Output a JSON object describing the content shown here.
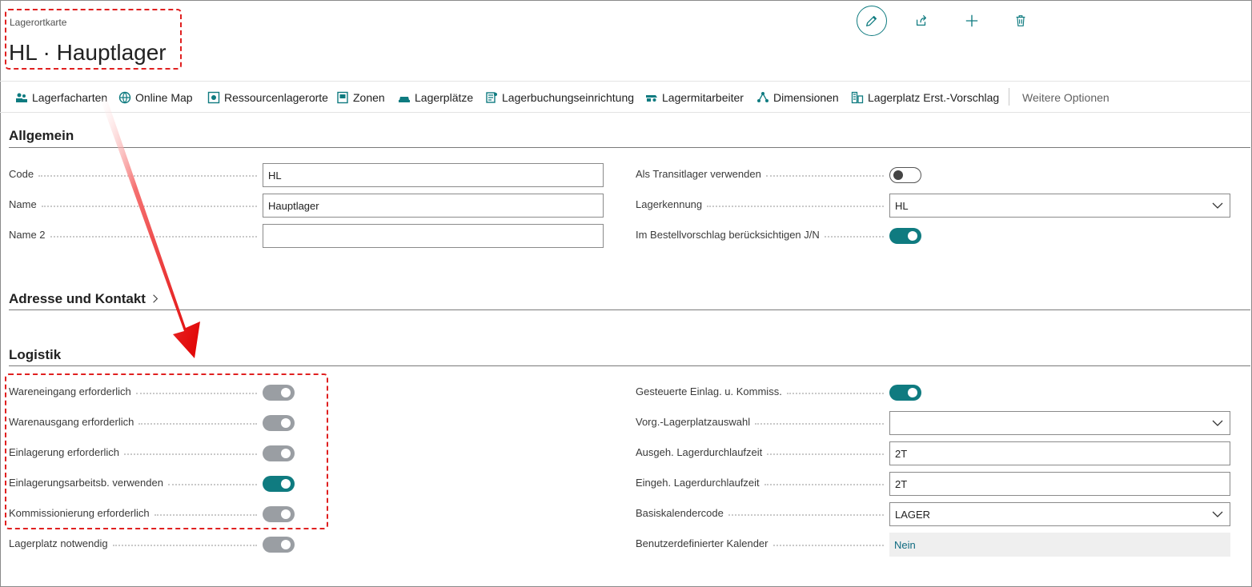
{
  "header": {
    "caption": "Lagerortkarte",
    "title": "HL · Hauptlager"
  },
  "top_actions": [
    {
      "name": "edit-icon"
    },
    {
      "name": "share-icon"
    },
    {
      "name": "plus-icon"
    },
    {
      "name": "delete-icon"
    }
  ],
  "actionbar": {
    "items": [
      {
        "label": "Lagerfacharten",
        "icon": "bin-types-icon"
      },
      {
        "label": "Online Map",
        "icon": "globe-icon"
      },
      {
        "label": "Ressourcenlagerorte",
        "icon": "resource-icon"
      },
      {
        "label": "Zonen",
        "icon": "zone-icon"
      },
      {
        "label": "Lagerplätze",
        "icon": "bin-icon"
      },
      {
        "label": "Lagerbuchungseinrichtung",
        "icon": "posting-setup-icon"
      },
      {
        "label": "Lagermitarbeiter",
        "icon": "employee-icon"
      },
      {
        "label": "Dimensionen",
        "icon": "dimensions-icon"
      },
      {
        "label": "Lagerplatz Erst.-Vorschlag",
        "icon": "bin-creation-icon"
      }
    ],
    "more_label": "Weitere Optionen"
  },
  "allgemein": {
    "title": "Allgemein",
    "code": {
      "label": "Code",
      "value": "HL"
    },
    "name": {
      "label": "Name",
      "value": "Hauptlager"
    },
    "name2": {
      "label": "Name 2",
      "value": ""
    },
    "transit": {
      "label": "Als Transitlager verwenden",
      "state": "off"
    },
    "lagerkennung": {
      "label": "Lagerkennung",
      "value": "HL"
    },
    "bestellvorschlag": {
      "label": "Im Bestellvorschlag berücksichtigen J/N",
      "state": "on"
    }
  },
  "adresse": {
    "title": "Adresse und Kontakt"
  },
  "logistik": {
    "title": "Logistik",
    "left": [
      {
        "label": "Wareneingang erforderlich",
        "state": "on-disabled"
      },
      {
        "label": "Warenausgang erforderlich",
        "state": "on-disabled"
      },
      {
        "label": "Einlagerung erforderlich",
        "state": "on-disabled"
      },
      {
        "label": "Einlagerungsarbeitsb. verwenden",
        "state": "on"
      },
      {
        "label": "Kommissionierung erforderlich",
        "state": "on-disabled"
      },
      {
        "label": "Lagerplatz notwendig",
        "state": "on-disabled"
      }
    ],
    "gesteuerte": {
      "label": "Gesteuerte Einlag. u. Kommiss.",
      "state": "on"
    },
    "vorg": {
      "label": "Vorg.-Lagerplatzauswahl",
      "value": ""
    },
    "ausgeh": {
      "label": "Ausgeh. Lagerdurchlaufzeit",
      "value": "2T"
    },
    "eingeh": {
      "label": "Eingeh. Lagerdurchlaufzeit",
      "value": "2T"
    },
    "basiskalender": {
      "label": "Basiskalendercode",
      "value": "LAGER"
    },
    "benutzer": {
      "label": "Benutzerdefinierter Kalender",
      "value": "Nein"
    }
  },
  "colors": {
    "accent": "#0f7b80",
    "highlight": "#e02020"
  }
}
